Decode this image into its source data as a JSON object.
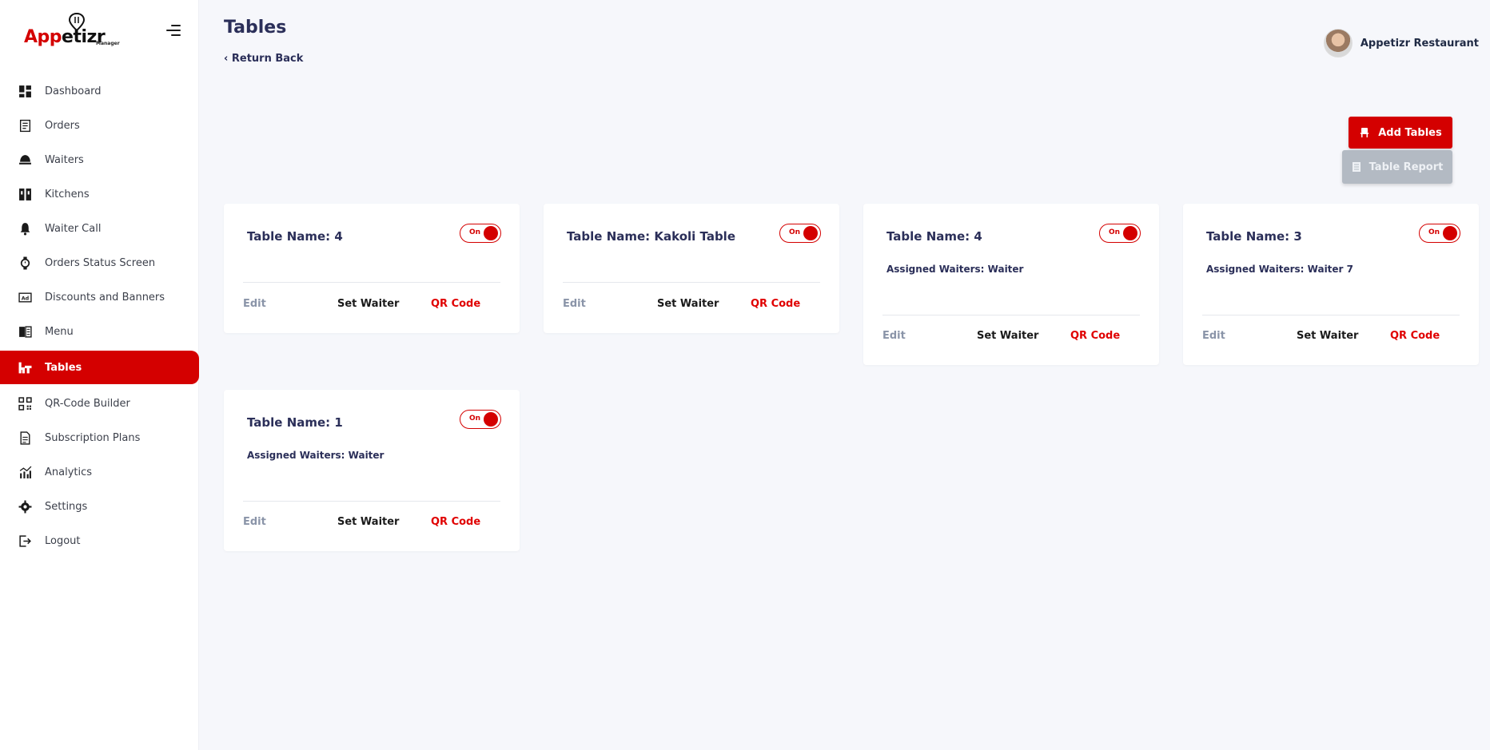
{
  "brand": {
    "name_red": "App",
    "name_black": "etizr",
    "sub": "Manager"
  },
  "sidebar": {
    "items": [
      {
        "label": "Dashboard",
        "icon": "dashboard-icon"
      },
      {
        "label": "Orders",
        "icon": "orders-icon"
      },
      {
        "label": "Waiters",
        "icon": "waiter-icon"
      },
      {
        "label": "Kitchens",
        "icon": "kitchen-icon"
      },
      {
        "label": "Waiter Call",
        "icon": "bell-icon"
      },
      {
        "label": "Orders Status Screen",
        "icon": "watch-icon"
      },
      {
        "label": "Discounts and Banners",
        "icon": "ad-icon"
      },
      {
        "label": "Menu",
        "icon": "menu-book-icon"
      },
      {
        "label": "Tables",
        "icon": "table-icon",
        "active": true
      },
      {
        "label": "QR-Code Builder",
        "icon": "qr-icon"
      },
      {
        "label": "Subscription Plans",
        "icon": "document-icon"
      },
      {
        "label": "Analytics",
        "icon": "analytics-icon"
      },
      {
        "label": "Settings",
        "icon": "gear-icon"
      },
      {
        "label": "Logout",
        "icon": "logout-icon"
      }
    ]
  },
  "header": {
    "title": "Tables",
    "return_back": "‹ Return Back",
    "profile_name": "Appetizr Restaurant"
  },
  "buttons": {
    "add_tables": "Add Tables",
    "table_report": "Table Report"
  },
  "cards": [
    {
      "title": "Table Name: 4",
      "toggle": "On",
      "assigned": "",
      "edit": "Edit",
      "set_waiter": "Set Waiter",
      "qr": "QR Code"
    },
    {
      "title": "Table Name: Kakoli Table",
      "toggle": "On",
      "assigned": "",
      "edit": "Edit",
      "set_waiter": "Set Waiter",
      "qr": "QR Code"
    },
    {
      "title": "Table Name: 4",
      "toggle": "On",
      "assigned": "Assigned Waiters: Waiter",
      "edit": "Edit",
      "set_waiter": "Set Waiter",
      "qr": "QR Code"
    },
    {
      "title": "Table Name: 3",
      "toggle": "On",
      "assigned": "Assigned Waiters: Waiter 7",
      "edit": "Edit",
      "set_waiter": "Set Waiter",
      "qr": "QR Code"
    },
    {
      "title": "Table Name: 1",
      "toggle": "On",
      "assigned": "Assigned Waiters: Waiter",
      "edit": "Edit",
      "set_waiter": "Set Waiter",
      "qr": "QR Code"
    }
  ],
  "colors": {
    "accent": "#d40000",
    "sidebar_bg": "#ffffff",
    "page_bg": "#f6f7fb",
    "title": "#2b2f59"
  }
}
